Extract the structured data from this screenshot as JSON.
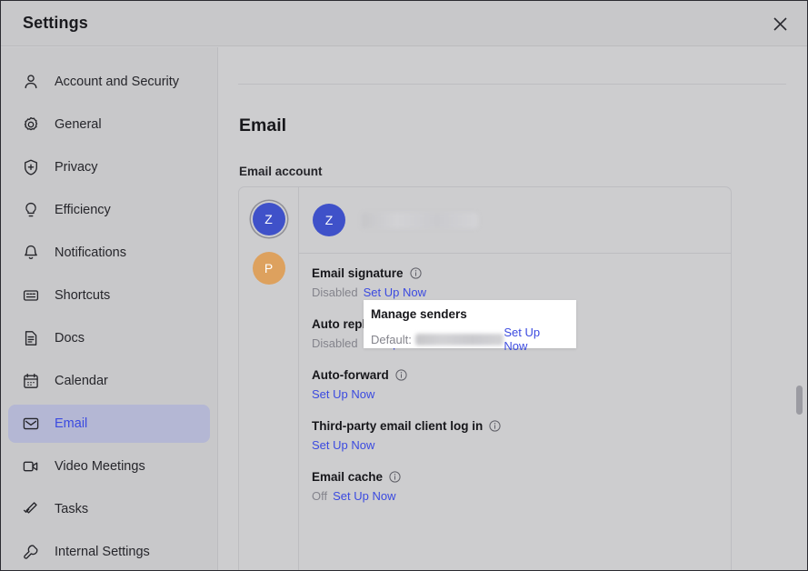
{
  "window": {
    "title": "Settings",
    "close_icon": "close-icon"
  },
  "sidebar": {
    "items": [
      {
        "label": "Account and Security",
        "icon": "person-icon",
        "active": false
      },
      {
        "label": "General",
        "icon": "gear-icon",
        "active": false
      },
      {
        "label": "Privacy",
        "icon": "shield-plus-icon",
        "active": false
      },
      {
        "label": "Efficiency",
        "icon": "lightbulb-icon",
        "active": false
      },
      {
        "label": "Notifications",
        "icon": "bell-icon",
        "active": false
      },
      {
        "label": "Shortcuts",
        "icon": "keyboard-icon",
        "active": false
      },
      {
        "label": "Docs",
        "icon": "document-icon",
        "active": false
      },
      {
        "label": "Calendar",
        "icon": "calendar-icon",
        "active": false
      },
      {
        "label": "Email",
        "icon": "envelope-icon",
        "active": true
      },
      {
        "label": "Video Meetings",
        "icon": "video-camera-icon",
        "active": false
      },
      {
        "label": "Tasks",
        "icon": "check-pencil-icon",
        "active": false
      },
      {
        "label": "Internal Settings",
        "icon": "wrench-icon",
        "active": false
      }
    ]
  },
  "main": {
    "page_title": "Email",
    "section_label": "Email account",
    "accounts": [
      {
        "initial": "Z",
        "color": "#3f51c9",
        "selected": true
      },
      {
        "initial": "P",
        "color": "#dda15e",
        "selected": false
      }
    ],
    "current_account": {
      "initial": "Z",
      "color": "#3f51c9",
      "name_redacted": true
    },
    "popup": {
      "title": "Manage senders",
      "state": "Default:",
      "value_redacted": true,
      "action": "Set Up Now"
    },
    "rows": [
      {
        "title": "Email signature",
        "has_info": true,
        "state": "Disabled",
        "action": "Set Up Now"
      },
      {
        "title": "Auto reply",
        "has_info": true,
        "state": "Disabled",
        "action": "Set Up Now"
      },
      {
        "title": "Auto-forward",
        "has_info": true,
        "state": "",
        "action": "Set Up Now"
      },
      {
        "title": "Third-party email client log in",
        "has_info": true,
        "state": "",
        "action": "Set Up Now"
      },
      {
        "title": "Email cache",
        "has_info": true,
        "state": "Off",
        "action": "Set Up Now"
      }
    ]
  },
  "colors": {
    "accent": "#3b4ae0",
    "sidebar_bg": "#c8c8ca",
    "content_bg": "#cdcdcf",
    "active_item_bg": "#b4b7d4",
    "muted_text": "#84848c"
  }
}
